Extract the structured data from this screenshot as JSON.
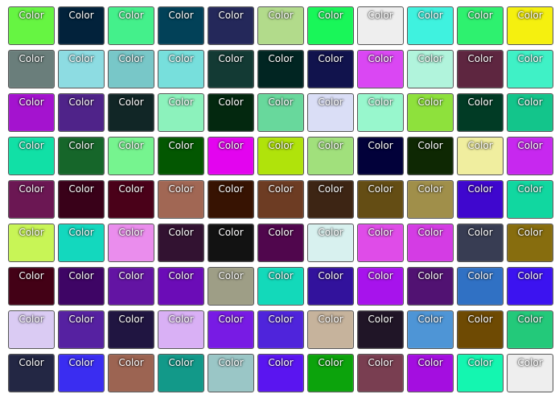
{
  "swatch_label": "Color",
  "rows": [
    [
      "#66f542",
      "#02223b",
      "#44f08b",
      "#024158",
      "#24285a",
      "#b2db8b",
      "#19f659",
      "#eeeeee",
      "#3ff2df",
      "#2ef16f",
      "#f5f00f"
    ],
    [
      "#6a7e7b",
      "#8ddce2",
      "#78c7c8",
      "#77dfdc",
      "#133a34",
      "#012522",
      "#11134d",
      "#da47f3",
      "#b1f4dc",
      "#5e2640",
      "#3ff1c6"
    ],
    [
      "#a413cf",
      "#4f2389",
      "#112626",
      "#8cf2bc",
      "#03280f",
      "#68d89c",
      "#dadef6",
      "#98f7cd",
      "#8ee13c",
      "#013b25",
      "#13c58b"
    ],
    [
      "#11e0a6",
      "#16662a",
      "#76f48f",
      "#035701",
      "#e304ef",
      "#b0e30b",
      "#a1e07c",
      "#02013a",
      "#0e2803",
      "#f0ee9f",
      "#c728ef"
    ],
    [
      "#6b1753",
      "#390119",
      "#4a0119",
      "#a16754",
      "#371302",
      "#6d3c23",
      "#3d2514",
      "#644d14",
      "#a08f4a",
      "#3f07ce",
      "#11d7a0"
    ],
    [
      "#c8f556",
      "#13d8be",
      "#ea8ded",
      "#321231",
      "#121212",
      "#50064d",
      "#d8f1ef",
      "#df4ce8",
      "#d43ce4",
      "#383d53",
      "#876d0e"
    ],
    [
      "#430116",
      "#3e0565",
      "#6314a3",
      "#6b0cb7",
      "#9e9e86",
      "#13d9ba",
      "#32129c",
      "#a713ec",
      "#511272",
      "#3071c4",
      "#3c13f0"
    ],
    [
      "#dacbf3",
      "#5621a1",
      "#201541",
      "#d9b0f5",
      "#781be4",
      "#4f24db",
      "#c6b39c",
      "#201527",
      "#4e95d6",
      "#6e4a03",
      "#23c97a"
    ],
    [
      "#232744",
      "#3a2df1",
      "#9c6452",
      "#129989",
      "#9ac6c6",
      "#5a15f0",
      "#0ca30c",
      "#793e51",
      "#a40ee0",
      "#14f6b0",
      "#eeeeee"
    ]
  ]
}
